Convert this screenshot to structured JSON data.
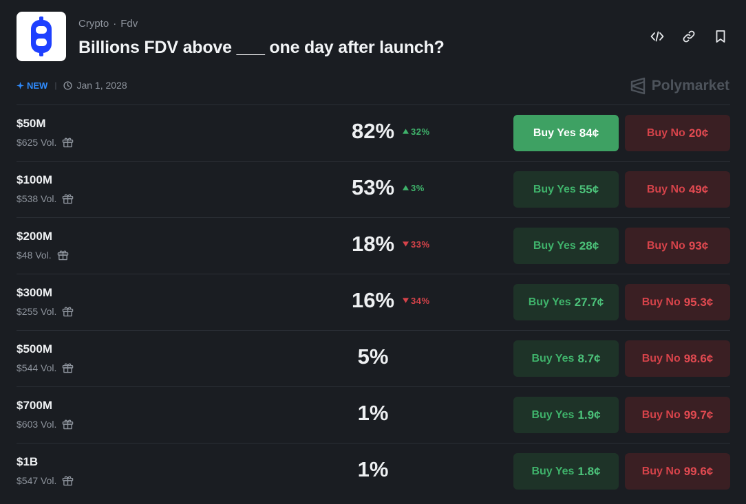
{
  "header": {
    "category": "Crypto",
    "subcategory": "Fdv",
    "separator": "·",
    "title": "Billions FDV above ___ one day after launch?",
    "logo_icon": "billions-b-logo"
  },
  "toolbar": {
    "icons": [
      "embed-code-icon",
      "link-icon",
      "bookmark-icon"
    ]
  },
  "meta": {
    "new_label": "NEW",
    "date": "Jan 1, 2028"
  },
  "brand": {
    "name": "Polymarket"
  },
  "colors": {
    "background": "#1a1d22",
    "yes_green": "#3fb36b",
    "no_red": "#d6434a",
    "accent_blue": "#2f8cff"
  },
  "markets": [
    {
      "label": "$50M",
      "volume": "$625 Vol.",
      "percent": "82%",
      "change": "32%",
      "direction": "up",
      "yes_label": "Buy Yes",
      "yes_price": "84¢",
      "no_label": "Buy No",
      "no_price": "20¢"
    },
    {
      "label": "$100M",
      "volume": "$538 Vol.",
      "percent": "53%",
      "change": "3%",
      "direction": "up",
      "yes_label": "Buy Yes",
      "yes_price": "55¢",
      "no_label": "Buy No",
      "no_price": "49¢"
    },
    {
      "label": "$200M",
      "volume": "$48 Vol.",
      "percent": "18%",
      "change": "33%",
      "direction": "down",
      "yes_label": "Buy Yes",
      "yes_price": "28¢",
      "no_label": "Buy No",
      "no_price": "93¢"
    },
    {
      "label": "$300M",
      "volume": "$255 Vol.",
      "percent": "16%",
      "change": "34%",
      "direction": "down",
      "yes_label": "Buy Yes",
      "yes_price": "27.7¢",
      "no_label": "Buy No",
      "no_price": "95.3¢"
    },
    {
      "label": "$500M",
      "volume": "$544 Vol.",
      "percent": "5%",
      "change": "",
      "direction": "",
      "yes_label": "Buy Yes",
      "yes_price": "8.7¢",
      "no_label": "Buy No",
      "no_price": "98.6¢"
    },
    {
      "label": "$700M",
      "volume": "$603 Vol.",
      "percent": "1%",
      "change": "",
      "direction": "",
      "yes_label": "Buy Yes",
      "yes_price": "1.9¢",
      "no_label": "Buy No",
      "no_price": "99.7¢"
    },
    {
      "label": "$1B",
      "volume": "$547 Vol.",
      "percent": "1%",
      "change": "",
      "direction": "",
      "yes_label": "Buy Yes",
      "yes_price": "1.8¢",
      "no_label": "Buy No",
      "no_price": "99.6¢"
    }
  ]
}
